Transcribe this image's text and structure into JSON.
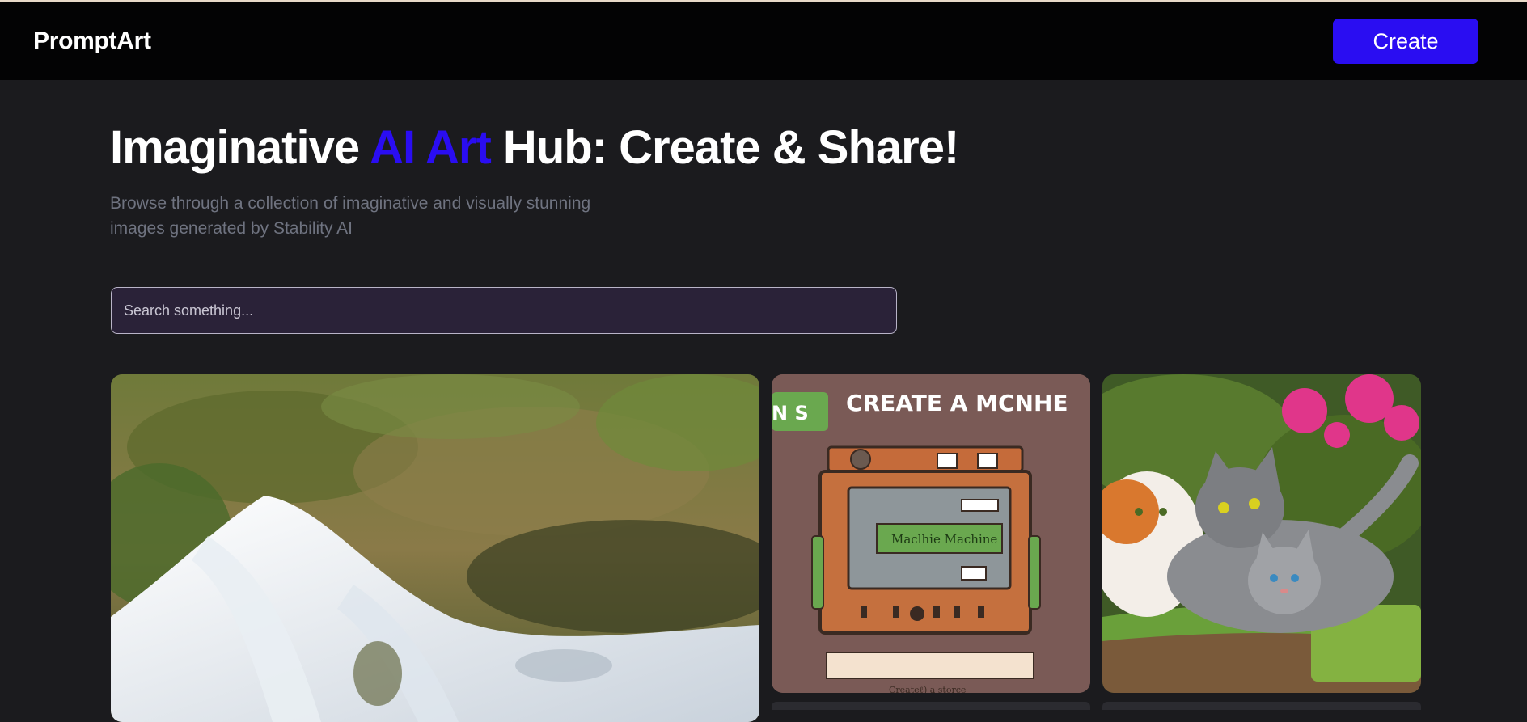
{
  "navbar": {
    "logo": "PromptArt",
    "create_label": "Create"
  },
  "hero": {
    "title_before": "Imaginative ",
    "title_accent": "AI Art",
    "title_after": " Hub: Create & Share!",
    "subtitle": "Browse through a collection of imaginative and visually stunning images generated by Stability AI"
  },
  "search": {
    "placeholder": "Search something..."
  },
  "gallery": {
    "cards": [
      {
        "name": "waterfall-image"
      },
      {
        "name": "machine-image",
        "heading": "CREATE A MCNHE",
        "tag": "N S",
        "screen_label": "Maclhie Machine",
        "caption": "Createℓ) a storce"
      },
      {
        "name": "cats-image"
      }
    ]
  },
  "colors": {
    "accent": "#2a0df2",
    "background": "#1b1b1e",
    "navbar": "#030304"
  }
}
